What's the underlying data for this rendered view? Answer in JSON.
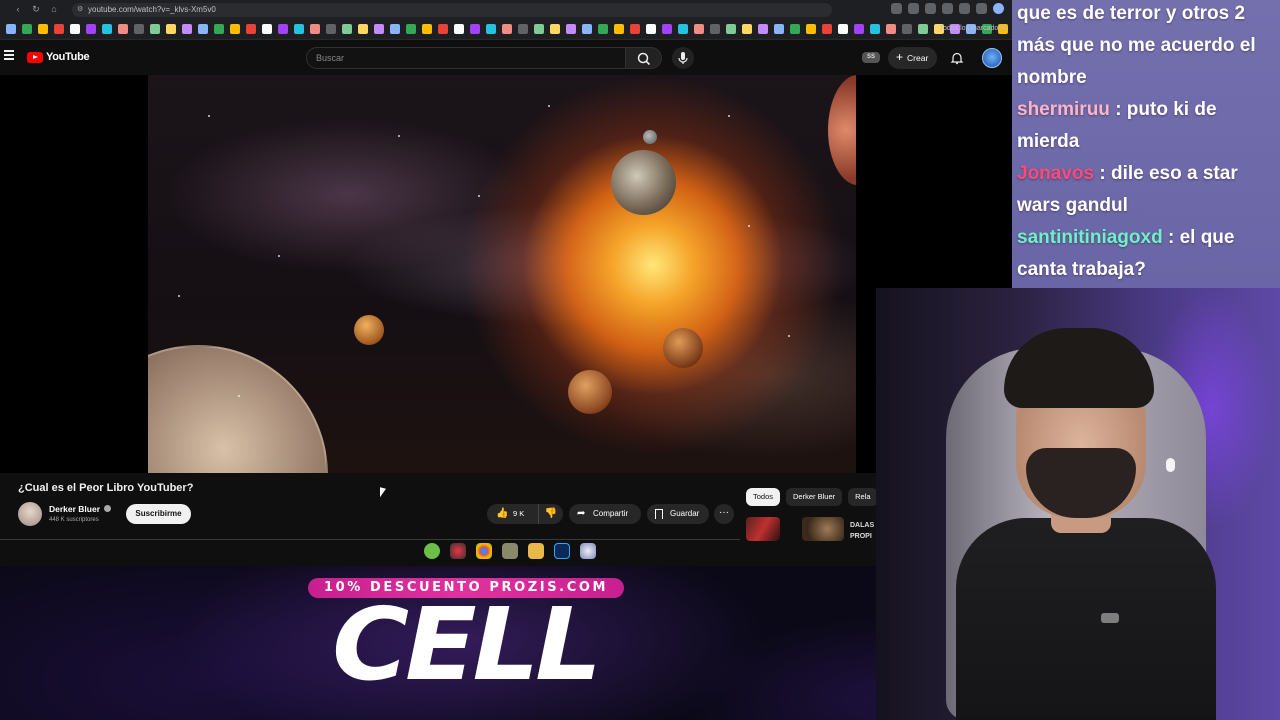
{
  "browser": {
    "url": "youtube.com/watch?v=_klvs-Xm5v0",
    "bookmarks_folder": "Todos los marcadores"
  },
  "youtube": {
    "logo_text": "YouTube",
    "search_placeholder": "Buscar",
    "ss_badge": "SS",
    "create_label": "Crear"
  },
  "video": {
    "title": "¿Cual es el Peor Libro YouTuber?",
    "channel_name": "Derker Bluer",
    "subscriber_count": "448 K suscriptores",
    "subscribe_label": "Suscribirme",
    "like_count": "9 K",
    "share_label": "Compartir",
    "save_label": "Guardar",
    "more_label": "···"
  },
  "recommendations": {
    "chips": [
      "Todos",
      "Derker Bluer",
      "Rela"
    ],
    "related_title": "DALAS PROPI"
  },
  "chat": {
    "messages": [
      {
        "user": "",
        "text": "que es de terror y otros 2"
      },
      {
        "user": "",
        "text": "más que no me acuerdo el"
      },
      {
        "user": "",
        "text": "nombre"
      },
      {
        "user": "shermiruu",
        "text": " : puto ki de",
        "color": "#ffb3c8"
      },
      {
        "user": "",
        "text": "mierda"
      },
      {
        "user": "Jonavos",
        "text": " : dile eso a star",
        "color": "#ff4a7a"
      },
      {
        "user": "",
        "text": "wars gandul"
      },
      {
        "user": "santinitiniagoxd",
        "text": " : el que",
        "color": "#6ff0c8"
      },
      {
        "user": "",
        "text": "canta trabaja?"
      }
    ]
  },
  "sponsor": {
    "promo_text": "10% DESCUENTO PROZIS.COM",
    "code": "CELL"
  },
  "colors": {
    "youtube_red": "#ff0000",
    "promo_pink": "#e0329e",
    "chat_bg": "#7470ae"
  }
}
